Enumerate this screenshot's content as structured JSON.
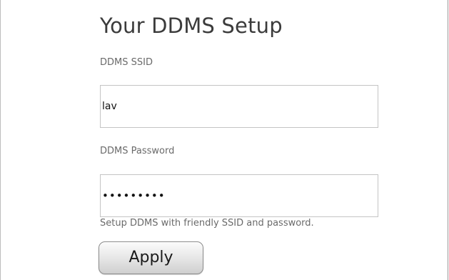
{
  "form": {
    "title": "Your DDMS Setup",
    "ssid_label": "DDMS SSID",
    "ssid_value": "lav",
    "password_label": "DDMS Password",
    "password_value": "lavender1",
    "hint": "Setup DDMS with friendly SSID and password.",
    "apply_label": "Apply"
  }
}
